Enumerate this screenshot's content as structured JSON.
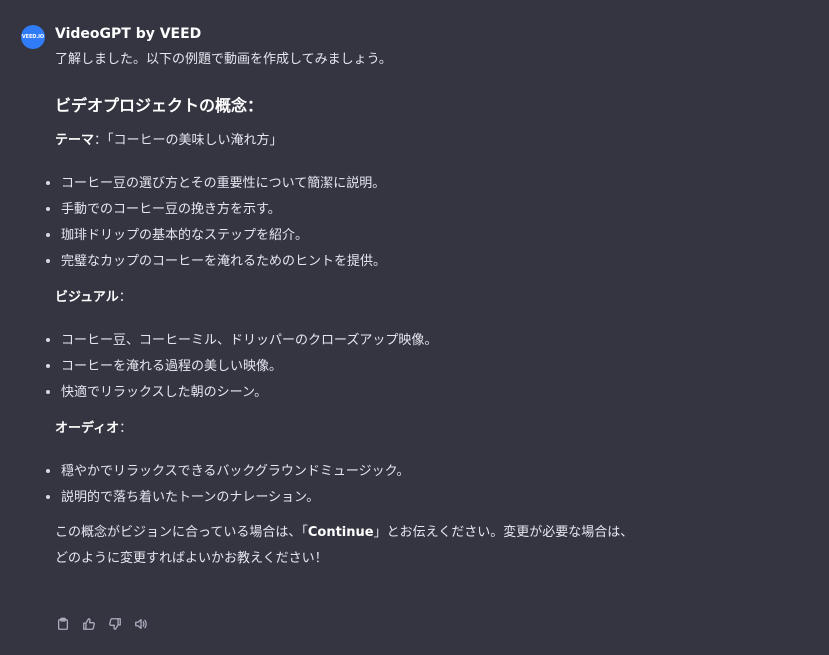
{
  "author": {
    "avatar_text": "VEED.IO",
    "name": "VideoGPT by VEED",
    "brand_color": "#2f7cf6"
  },
  "message": {
    "intro": "了解しました。以下の例題で動画を作成してみましょう。",
    "heading": "ビデオプロジェクトの概念：",
    "theme": {
      "label": "テーマ",
      "value": "：「コーヒーの美味しい淹れ方」"
    },
    "theme_points": [
      "コーヒー豆の選び方とその重要性について簡潔に説明。",
      "手動でのコーヒー豆の挽き方を示す。",
      "珈琲ドリップの基本的なステップを紹介。",
      "完璧なカップのコーヒーを淹れるためのヒントを提供。"
    ],
    "visual": {
      "label": "ビジュアル",
      "suffix": "：",
      "points": [
        "コーヒー豆、コーヒーミル、ドリッパーのクローズアップ映像。",
        "コーヒーを淹れる過程の美しい映像。",
        "快適でリラックスした朝のシーン。"
      ]
    },
    "audio": {
      "label": "オーディオ",
      "suffix": "：",
      "points": [
        "穏やかでリラックスできるバックグラウンドミュージック。",
        "説明的で落ち着いたトーンのナレーション。"
      ]
    },
    "outro": {
      "before": "この概念がビジョンに合っている場合は、「",
      "keyword": "Continue",
      "after": "」とお伝えください。変更が必要な場合は、どのように変更すればよいかお教えください！"
    }
  },
  "actions": [
    {
      "icon": "clipboard-icon"
    },
    {
      "icon": "thumbs-up-icon"
    },
    {
      "icon": "thumbs-down-icon"
    },
    {
      "icon": "speaker-icon"
    }
  ]
}
